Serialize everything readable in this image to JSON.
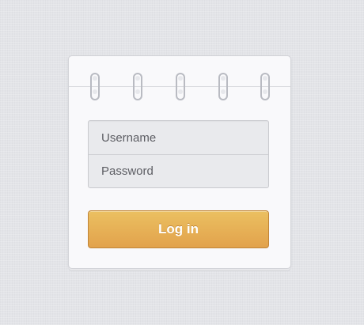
{
  "login_form": {
    "username_placeholder": "Username",
    "password_placeholder": "Password",
    "login_label": "Log in"
  },
  "binding": {
    "ring_count": 5
  },
  "colors": {
    "accent": "#e4ac55",
    "background": "#e3e4e8",
    "card": "#f9f9fb"
  },
  "icons": [
    "spiral-ring-icon"
  ]
}
